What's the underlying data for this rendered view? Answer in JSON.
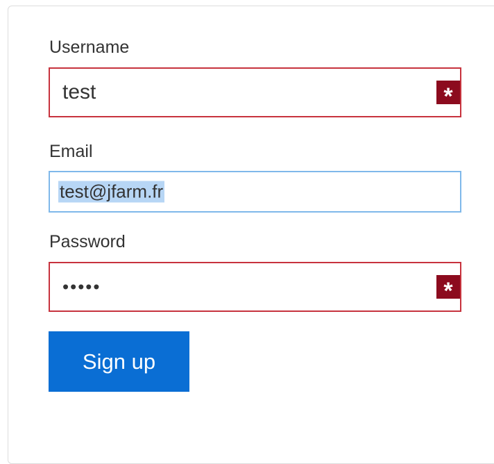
{
  "form": {
    "username": {
      "label": "Username",
      "value": "test",
      "required_mark": "*"
    },
    "email": {
      "label": "Email",
      "value": "test@jfarm.fr"
    },
    "password": {
      "label": "Password",
      "value": "•••••",
      "required_mark": "*"
    },
    "submit_label": "Sign up"
  },
  "colors": {
    "error_border": "#c7323d",
    "required_icon_bg": "#8c0b1e",
    "focus_border": "#7fb8ea",
    "selection": "#b7d6f5",
    "button_bg": "#0a6ed4"
  }
}
